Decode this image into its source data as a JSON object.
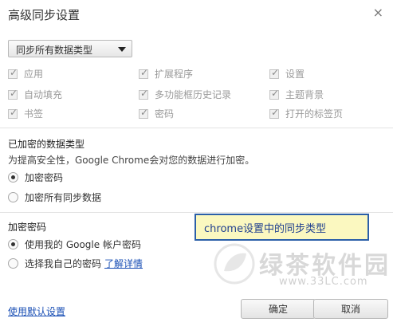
{
  "dialog": {
    "title": "高级同步设置",
    "close_icon": "×"
  },
  "sync_select": {
    "value": "同步所有数据类型"
  },
  "data_types": [
    {
      "label": "应用",
      "checked": true
    },
    {
      "label": "扩展程序",
      "checked": true
    },
    {
      "label": "设置",
      "checked": true
    },
    {
      "label": "自动填充",
      "checked": true
    },
    {
      "label": "多功能框历史记录",
      "checked": true
    },
    {
      "label": "主题背景",
      "checked": true
    },
    {
      "label": "书签",
      "checked": true
    },
    {
      "label": "密码",
      "checked": true
    },
    {
      "label": "打开的标签页",
      "checked": true
    }
  ],
  "encrypted": {
    "title": "已加密的数据类型",
    "description": "为提高安全性，Google Chrome会对您的数据进行加密。",
    "options": [
      {
        "label": "加密密码",
        "selected": true
      },
      {
        "label": "加密所有同步数据",
        "selected": false
      }
    ]
  },
  "passphrase": {
    "title": "加密密码",
    "options": [
      {
        "label": "使用我的 Google 帐户密码",
        "selected": true
      },
      {
        "label": "选择我自己的密码",
        "selected": false
      }
    ],
    "learn_more": "了解详情"
  },
  "callout": {
    "text": "chrome设置中的同步类型"
  },
  "footer": {
    "default_link": "使用默认设置",
    "ok": "确定",
    "cancel": "取消"
  },
  "watermark": {
    "name": "绿茶软件园",
    "url": "www.33LC.com"
  }
}
